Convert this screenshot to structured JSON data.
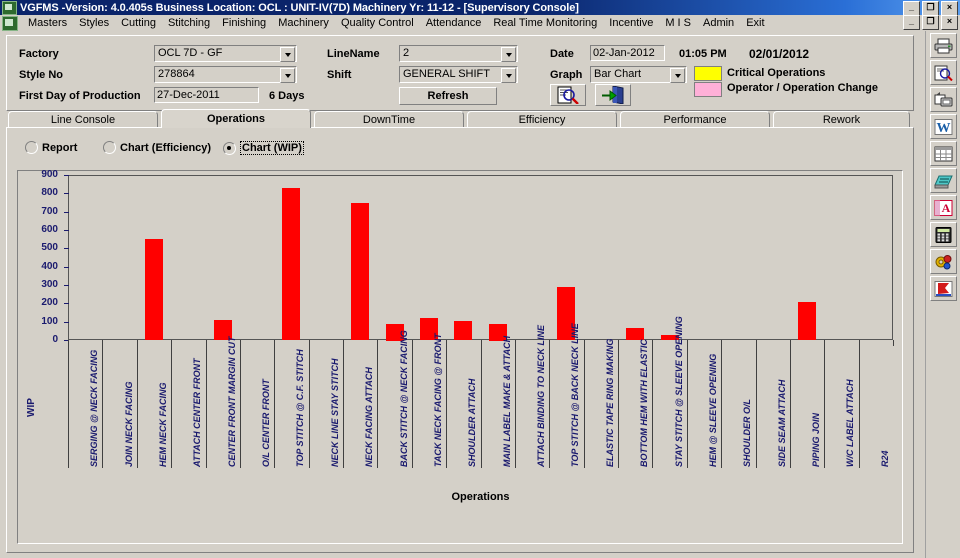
{
  "window": {
    "title": "VGFMS -Version: 4.0.405s Business Location: OCL : UNIT-IV(7D)   Machinery Yr: 11-12  - [Supervisory Console]",
    "minimize": "_",
    "restore": "❐",
    "close": "×",
    "icon": "app-icon"
  },
  "menu": {
    "items": [
      {
        "label": "Masters"
      },
      {
        "label": "Styles"
      },
      {
        "label": "Cutting"
      },
      {
        "label": "Stitching"
      },
      {
        "label": "Finishing"
      },
      {
        "label": "Machinery"
      },
      {
        "label": "Quality Control"
      },
      {
        "label": "Attendance"
      },
      {
        "label": "Real Time Monitoring"
      },
      {
        "label": "Incentive"
      },
      {
        "label": "M I S"
      },
      {
        "label": "Admin"
      },
      {
        "label": "Exit"
      }
    ],
    "minimize": "_",
    "restore": "❐",
    "close": "×"
  },
  "params": {
    "factory_label": "Factory",
    "factory_value": "OCL 7D - GF",
    "style_label": "Style No",
    "style_value": "278864",
    "first_day_label": "First Day of Production",
    "first_day_value": "27-Dec-2011",
    "days_text": "6 Days",
    "linename_label": "LineName",
    "linename_value": "2",
    "shift_label": "Shift",
    "shift_value": "GENERAL SHIFT",
    "refresh_label": "Refresh",
    "date_label": "Date",
    "date_value": "02-Jan-2012",
    "time_value": "01:05 PM",
    "date2_value": "02/01/2012",
    "graph_label": "Graph",
    "graph_value": "Bar Chart",
    "legend": [
      {
        "color": "#ffff00",
        "label": "Critical Operations"
      },
      {
        "color": "#ffb0d8",
        "label": "Operator / Operation Change"
      }
    ],
    "preview_icon": "print-preview-icon",
    "exit_icon": "exit-door-icon"
  },
  "tabs": [
    {
      "label": "Line Console",
      "active": false
    },
    {
      "label": "Operations",
      "active": true
    },
    {
      "label": "DownTime",
      "active": false
    },
    {
      "label": "Efficiency",
      "active": false
    },
    {
      "label": "Performance",
      "active": false
    },
    {
      "label": "Rework",
      "active": false
    }
  ],
  "view_modes": [
    {
      "label": "Report",
      "selected": false
    },
    {
      "label": "Chart (Efficiency)",
      "selected": false
    },
    {
      "label": "Chart (WIP)",
      "selected": true
    }
  ],
  "right_toolbar": [
    {
      "icon": "printer-icon"
    },
    {
      "icon": "print-preview-icon"
    },
    {
      "icon": "fax-icon"
    },
    {
      "icon": "word-export-icon"
    },
    {
      "icon": "grid-export-icon"
    },
    {
      "icon": "notepad-export-icon"
    },
    {
      "icon": "pdf-export-icon"
    },
    {
      "icon": "calculator-icon"
    },
    {
      "icon": "settings-icon"
    },
    {
      "icon": "red-flag-icon"
    }
  ],
  "chart_data": {
    "type": "bar",
    "title": "",
    "xlabel": "Operations",
    "ylabel": "WIP",
    "ylim": [
      0,
      900
    ],
    "yticks": [
      0,
      100,
      200,
      300,
      400,
      500,
      600,
      700,
      800,
      900
    ],
    "grid": false,
    "legend_position": "none",
    "bar_color": "#ff0000",
    "categories": [
      "SERGING @ NECK FACING",
      "JOIN NECK FACING",
      "HEM NECK FACING",
      "ATTACH CENTER FRONT",
      "CENTER FRONT MARGIN CUT",
      "O/L CENTER FRONT",
      "TOP STITCH @ C.F. STITCH",
      "NECK LINE STAY STITCH",
      "NECK FACING ATTACH",
      "BACK STITCH @ NECK FACING",
      "TACK NECK FACING @ FRONT",
      "SHOULDER ATTACH",
      "MAIN LABEL MAKE & ATTACH",
      "ATTACH BINDING TO NECK LINE",
      "TOP STITCH @ BACK NECK LINE",
      "ELASTIC TAPE RING MAKING",
      "BOTTOM HEM WITH ELASTIC",
      "STAY STITCH @ SLEEVE OPENING",
      "HEM @ SLEEVE OPENING",
      "SHOULDER O/L",
      "SIDE SEAM ATTACH",
      "PIPING JOIN",
      "W/C LABEL ATTACH",
      "R24"
    ],
    "values": [
      0,
      0,
      550,
      0,
      110,
      0,
      830,
      0,
      745,
      90,
      120,
      105,
      90,
      0,
      290,
      0,
      65,
      25,
      0,
      0,
      0,
      205,
      0,
      0
    ]
  }
}
